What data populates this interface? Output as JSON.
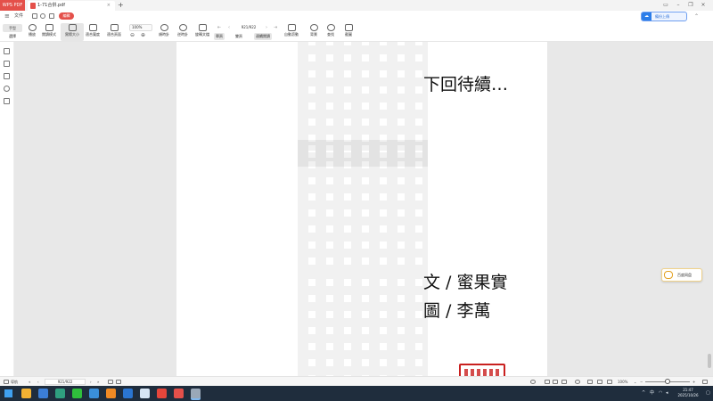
{
  "titlebar": {
    "app_tab": "WPS PDF",
    "doc_tab_title": "1-71合併.pdf",
    "doc_tab_close": "×",
    "new_tab": "+"
  },
  "menu": {
    "file": "文件",
    "edit_badge": "編輯",
    "upload_button": "備份上傳"
  },
  "toolbar": {
    "hand": "手型",
    "select": "選擇",
    "items": [
      {
        "label": "播放"
      },
      {
        "label": "閱讀模式"
      },
      {
        "label": "實際大小"
      },
      {
        "label": "適合寬度"
      },
      {
        "label": "適合頁面"
      }
    ],
    "zoom_value": "100%",
    "zoom_out": "⊖",
    "zoom_in": "⊕",
    "rotate_left": "順時針",
    "rotate_right": "逆時針",
    "rotate_doc": "旋轉文檔",
    "page_indicator": "921/922",
    "view_modes": {
      "single": "單頁",
      "double": "雙頁",
      "continuous": "連續閱讀"
    },
    "auto_scroll": "自動滾動",
    "background": "背景",
    "search": "查找",
    "screen_capture": "截圖",
    "compare": "文檔對比"
  },
  "page": {
    "line1": "下回待續…",
    "line2": "文 / 蜜果實",
    "line3": "圖 / 李萬"
  },
  "widget": {
    "baidu_label": "百度网盘"
  },
  "statusbar": {
    "thumbnail_label": "導航",
    "page_indicator": "921/922",
    "zoom_value": "100%"
  },
  "taskbar": {
    "time": "21:47",
    "date": "2025/10/26",
    "lang": "中",
    "apps": [
      {
        "name": "file-explorer",
        "color": "#f2b233"
      },
      {
        "name": "store",
        "color": "#3b7ed6"
      },
      {
        "name": "edge",
        "color": "#2f9f7f"
      },
      {
        "name": "wechat",
        "color": "#2fbf3c"
      },
      {
        "name": "browser-blue",
        "color": "#3a8fd9"
      },
      {
        "name": "orange-app",
        "color": "#f08a24"
      },
      {
        "name": "blue-app",
        "color": "#2a75d1"
      },
      {
        "name": "light-app",
        "color": "#d7e6f5"
      },
      {
        "name": "chrome",
        "color": "#e5463b"
      },
      {
        "name": "wps-pdf",
        "color": "#e4504a"
      },
      {
        "name": "pdf-viewer",
        "color": "#9aa8b8"
      }
    ]
  }
}
